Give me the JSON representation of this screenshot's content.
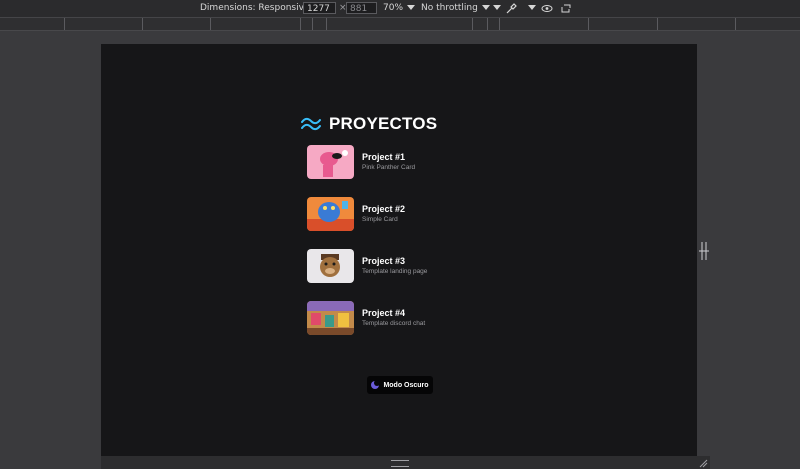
{
  "devtools": {
    "dimensions_label": "Dimensions: Responsive",
    "width": "1277",
    "times": "×",
    "height": "881",
    "zoom": "70%",
    "throttling": "No throttling"
  },
  "page": {
    "title": "PROYECTOS",
    "projects": [
      {
        "name": "Project #1",
        "desc": "Pink Panther Card"
      },
      {
        "name": "Project #2",
        "desc": "Simple Card"
      },
      {
        "name": "Project #3",
        "desc": "Template landing page"
      },
      {
        "name": "Project #4",
        "desc": "Template discord chat"
      }
    ],
    "dark_mode_label": "Modo Oscuro"
  },
  "colors": {
    "tailwind_accent": "#38bdf8",
    "page_bg": "#161618",
    "chrome_bg": "#2b2b2d"
  },
  "icons": {
    "logo": "tailwind-logo-icon",
    "dark_mode": "moon-icon",
    "pick": "eyedropper-icon",
    "vision": "eye-icon",
    "rotate": "rotate-icon"
  }
}
